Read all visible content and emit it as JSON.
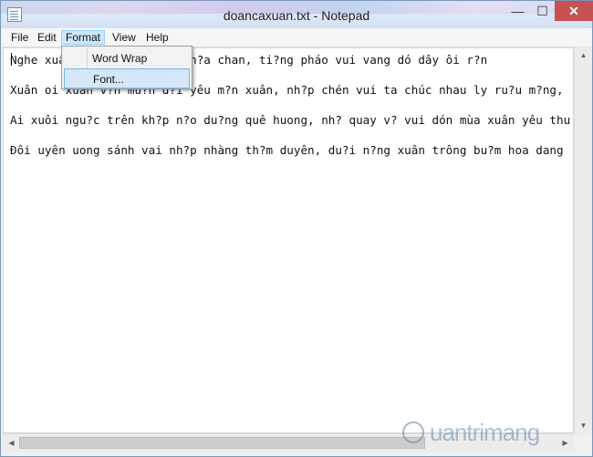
{
  "window": {
    "title": "doancaxuan.txt - Notepad",
    "minimize_glyph": "—",
    "maximize_glyph": "☐",
    "close_glyph": "✕"
  },
  "menu": {
    "file": "File",
    "edit": "Edit",
    "format": "Format",
    "view": "View",
    "help": "Help"
  },
  "format_menu": {
    "items": [
      "Word Wrap",
      "Font..."
    ],
    "highlighted": "Font..."
  },
  "editor": {
    "lines": [
      "Nghe xuân  ng? lòng mình ch?a chan, ti?ng pháo vui vang dó dây ôi r?n",
      "Xuân oi xuân v?n mu?n d?i yêu m?n xuân, nh?p chén vui ta chúc nhau ly ru?u m?ng,",
      "Ai xuôi ngu?c trên kh?p n?o du?ng quê huong, nh? quay v? vui dón mùa xuân yêu thu",
      "Ðôi uyên uong sánh vai nh?p nhàng th?m duyên, du?i n?ng xuân trông bu?m hoa dang"
    ]
  },
  "watermark": {
    "text": "uantrimang"
  },
  "colors": {
    "accent": "#cce8ff",
    "close_button": "#c75050",
    "menu_highlight": "#d5e7f8"
  }
}
